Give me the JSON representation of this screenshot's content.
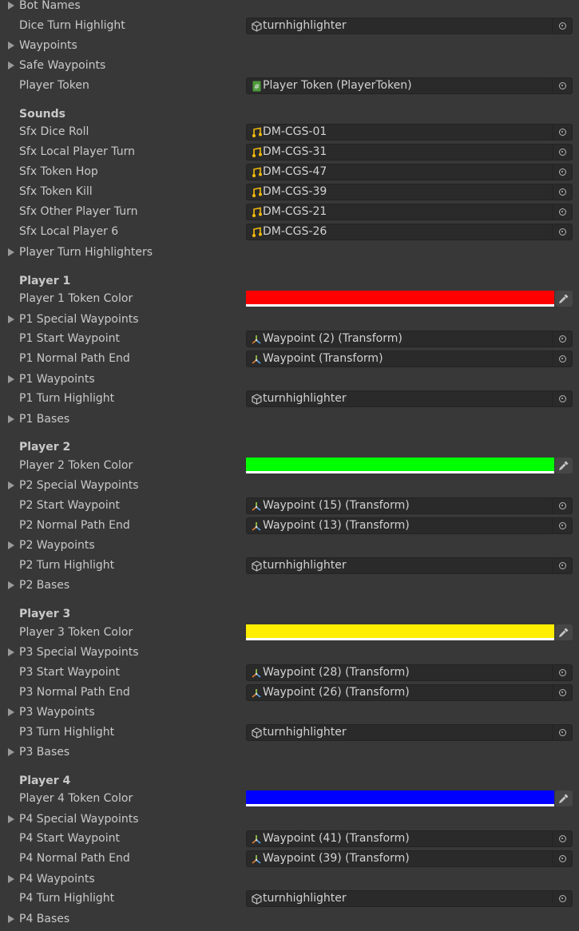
{
  "rows": [
    {
      "kind": "foldout",
      "label": "Bot Names"
    },
    {
      "kind": "field",
      "label": "Dice Turn Highlight",
      "value": "turnhighlighter",
      "icon": "cube-icon"
    },
    {
      "kind": "foldout",
      "label": "Waypoints"
    },
    {
      "kind": "foldout",
      "label": "Safe Waypoints"
    },
    {
      "kind": "field",
      "label": "Player Token",
      "value": "Player Token (PlayerToken)",
      "icon": "script-icon"
    },
    {
      "kind": "header",
      "label": "Sounds"
    },
    {
      "kind": "field",
      "label": "Sfx Dice Roll",
      "value": "DM-CGS-01",
      "icon": "audio-icon"
    },
    {
      "kind": "field",
      "label": "Sfx Local Player Turn",
      "value": "DM-CGS-31",
      "icon": "audio-icon"
    },
    {
      "kind": "field",
      "label": "Sfx Token Hop",
      "value": "DM-CGS-47",
      "icon": "audio-icon"
    },
    {
      "kind": "field",
      "label": "Sfx Token Kill",
      "value": "DM-CGS-39",
      "icon": "audio-icon"
    },
    {
      "kind": "field",
      "label": "Sfx Other Player Turn",
      "value": "DM-CGS-21",
      "icon": "audio-icon"
    },
    {
      "kind": "field",
      "label": "Sfx Local Player 6",
      "value": "DM-CGS-26",
      "icon": "audio-icon"
    },
    {
      "kind": "foldout",
      "label": "Player Turn Highlighters"
    },
    {
      "kind": "header",
      "label": "Player 1"
    },
    {
      "kind": "color",
      "label": "Player 1 Token Color",
      "color": "#ff0000"
    },
    {
      "kind": "foldout",
      "label": "P1 Special Waypoints"
    },
    {
      "kind": "field",
      "label": "P1 Start Waypoint",
      "value": "Waypoint (2) (Transform)",
      "icon": "transform-icon"
    },
    {
      "kind": "field",
      "label": "P1 Normal Path End",
      "value": "Waypoint (Transform)",
      "icon": "transform-icon"
    },
    {
      "kind": "foldout",
      "label": "P1 Waypoints"
    },
    {
      "kind": "field",
      "label": "P1 Turn Highlight",
      "value": "turnhighlighter",
      "icon": "cube-icon"
    },
    {
      "kind": "foldout",
      "label": "P1 Bases"
    },
    {
      "kind": "header",
      "label": "Player 2"
    },
    {
      "kind": "color",
      "label": "Player 2 Token Color",
      "color": "#00ff00"
    },
    {
      "kind": "foldout",
      "label": "P2 Special Waypoints"
    },
    {
      "kind": "field",
      "label": "P2 Start Waypoint",
      "value": "Waypoint (15) (Transform)",
      "icon": "transform-icon"
    },
    {
      "kind": "field",
      "label": "P2 Normal Path End",
      "value": "Waypoint (13) (Transform)",
      "icon": "transform-icon"
    },
    {
      "kind": "foldout",
      "label": "P2 Waypoints"
    },
    {
      "kind": "field",
      "label": "P2 Turn Highlight",
      "value": "turnhighlighter",
      "icon": "cube-icon"
    },
    {
      "kind": "foldout",
      "label": "P2 Bases"
    },
    {
      "kind": "header",
      "label": "Player 3"
    },
    {
      "kind": "color",
      "label": "Player 3 Token Color",
      "color": "#ffee00"
    },
    {
      "kind": "foldout",
      "label": "P3 Special Waypoints"
    },
    {
      "kind": "field",
      "label": "P3 Start Waypoint",
      "value": "Waypoint (28) (Transform)",
      "icon": "transform-icon"
    },
    {
      "kind": "field",
      "label": "P3 Normal Path End",
      "value": "Waypoint (26) (Transform)",
      "icon": "transform-icon"
    },
    {
      "kind": "foldout",
      "label": "P3 Waypoints"
    },
    {
      "kind": "field",
      "label": "P3 Turn Highlight",
      "value": "turnhighlighter",
      "icon": "cube-icon"
    },
    {
      "kind": "foldout",
      "label": "P3 Bases"
    },
    {
      "kind": "header",
      "label": "Player 4"
    },
    {
      "kind": "color",
      "label": "Player 4 Token Color",
      "color": "#0000ff"
    },
    {
      "kind": "foldout",
      "label": "P4 Special Waypoints"
    },
    {
      "kind": "field",
      "label": "P4 Start Waypoint",
      "value": "Waypoint (41) (Transform)",
      "icon": "transform-icon"
    },
    {
      "kind": "field",
      "label": "P4 Normal Path End",
      "value": "Waypoint (39) (Transform)",
      "icon": "transform-icon"
    },
    {
      "kind": "foldout",
      "label": "P4 Waypoints"
    },
    {
      "kind": "field",
      "label": "P4 Turn Highlight",
      "value": "turnhighlighter",
      "icon": "cube-icon"
    },
    {
      "kind": "foldout",
      "label": "P4 Bases"
    }
  ]
}
